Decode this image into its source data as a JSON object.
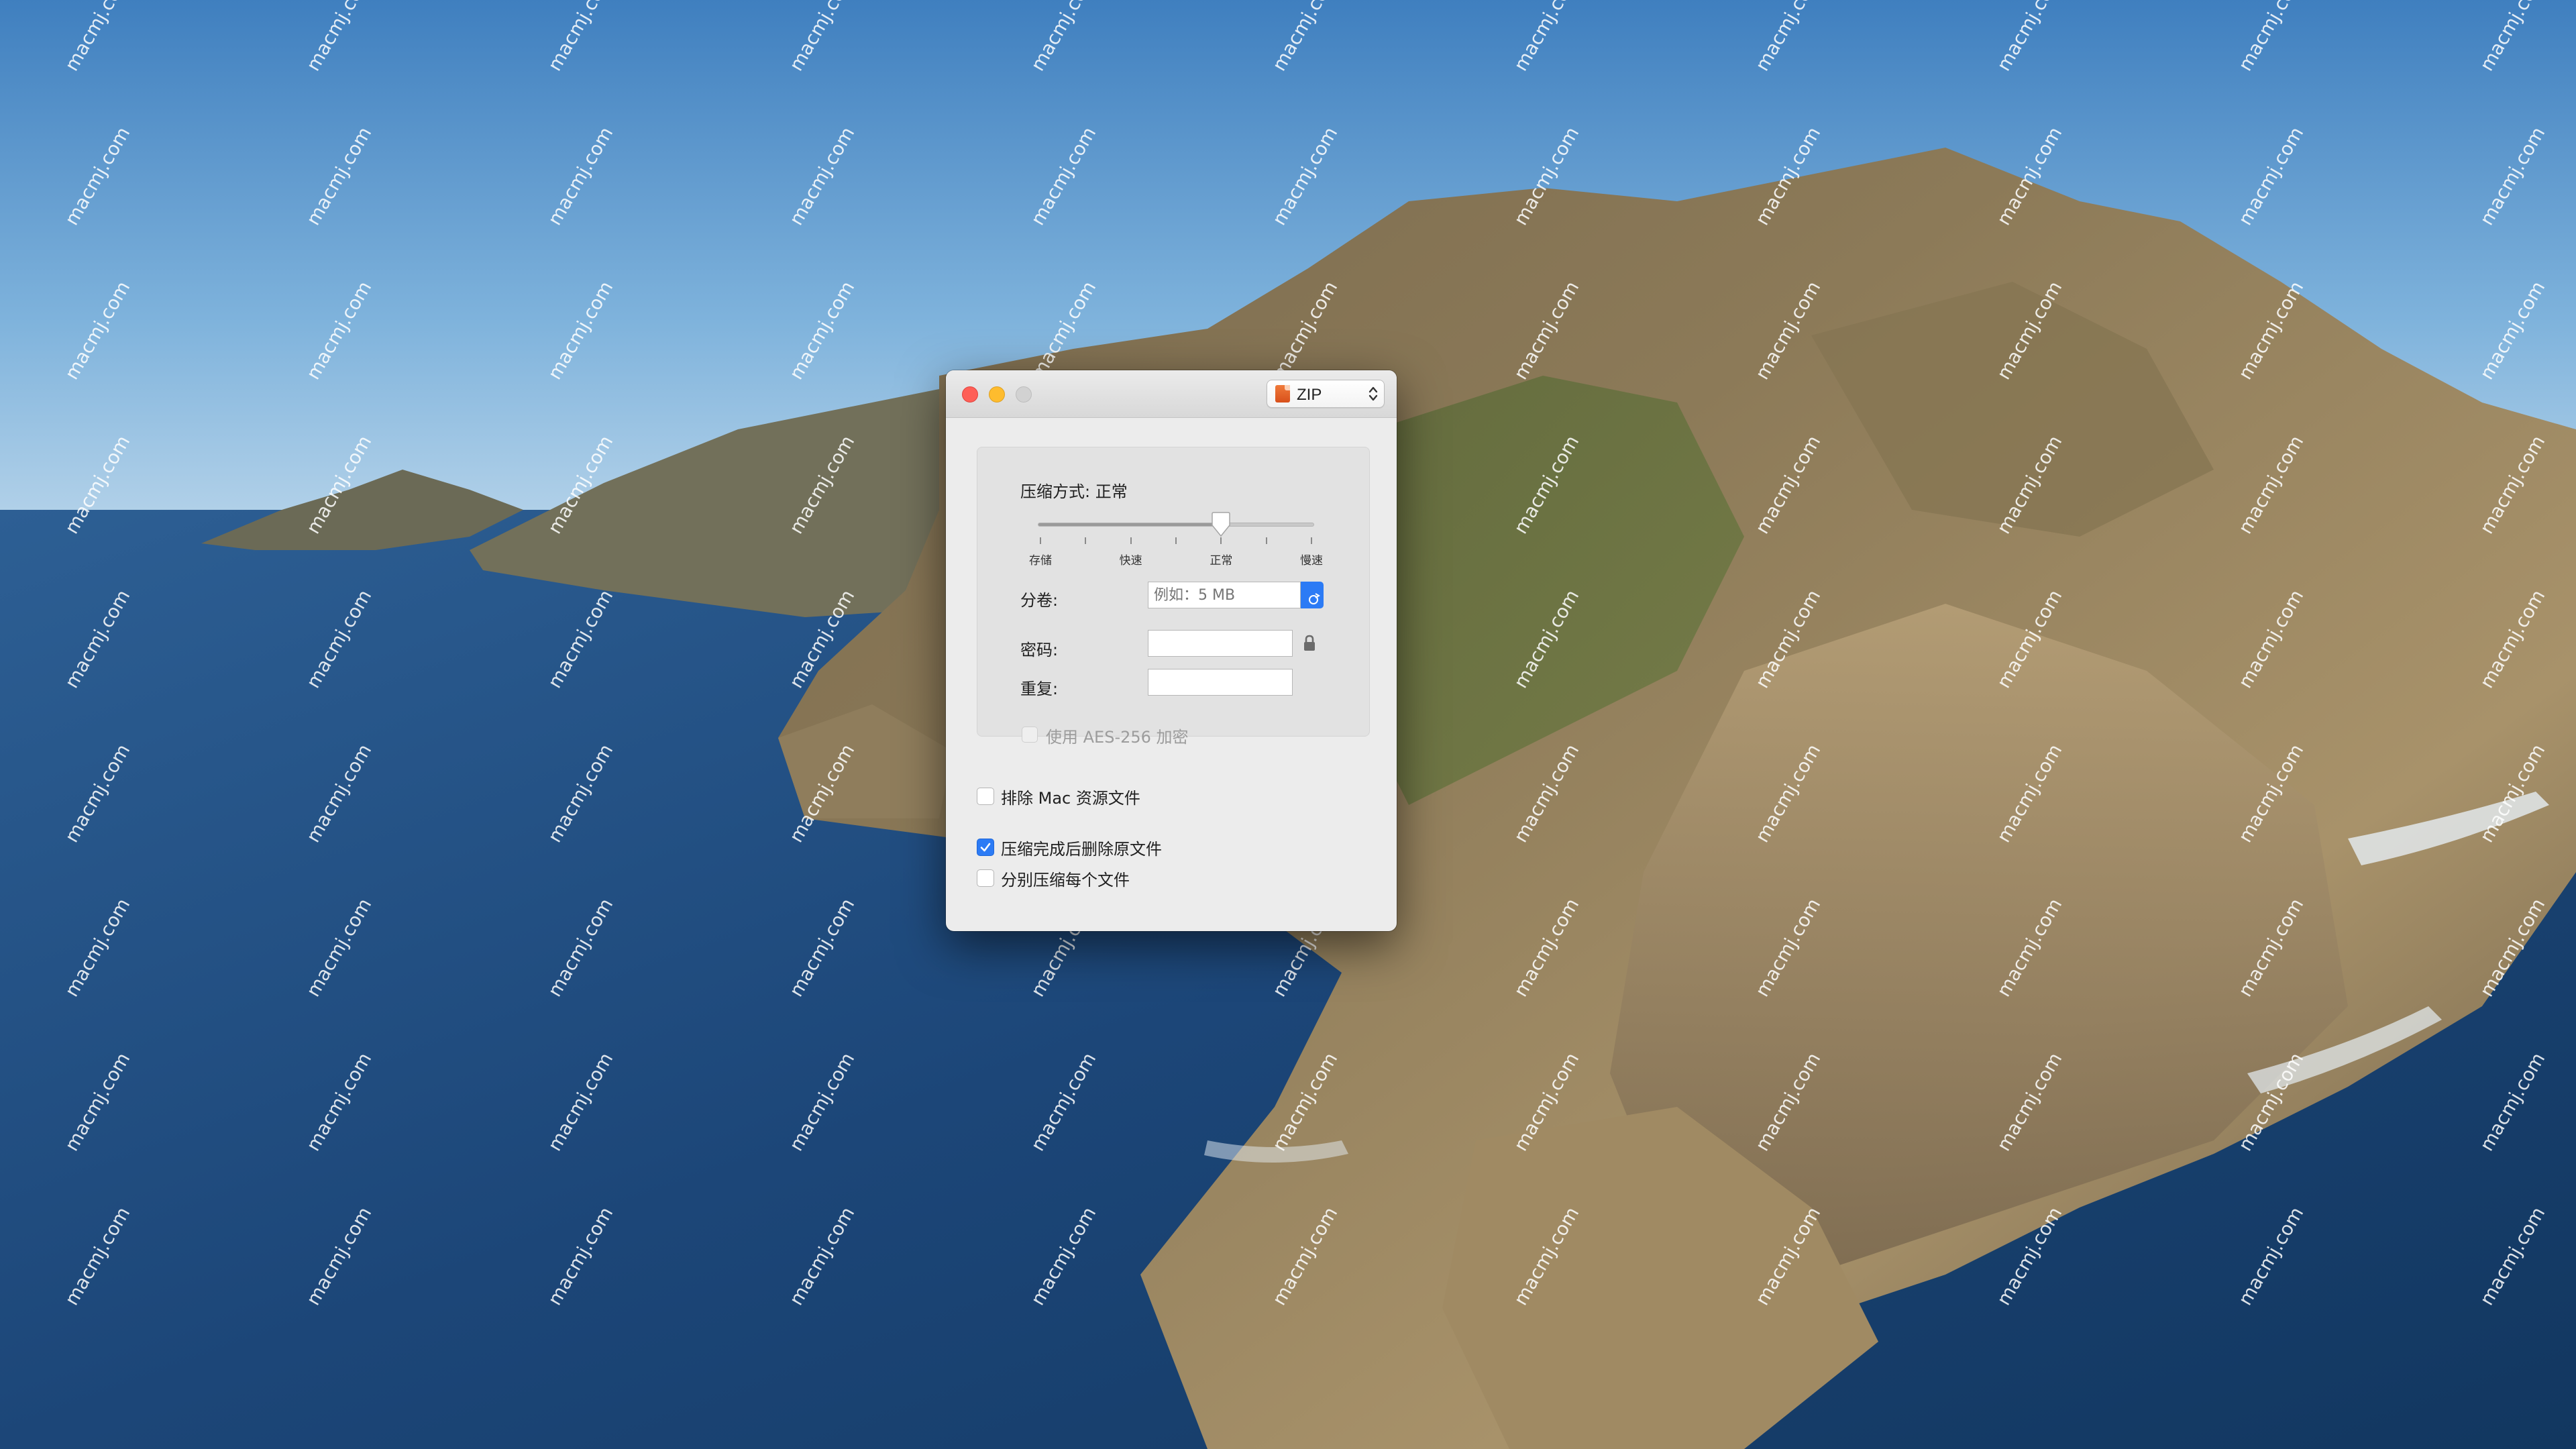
{
  "window": {
    "format": "ZIP",
    "format_icon": "zip-archive-icon"
  },
  "compression": {
    "label": "压缩方式: 正常",
    "level_index": 2,
    "levels": [
      "存储",
      "快速",
      "正常",
      "慢速"
    ]
  },
  "split": {
    "label": "分卷:",
    "placeholder": "例如：5 MB"
  },
  "password": {
    "label": "密码:",
    "value": ""
  },
  "repeat": {
    "label": "重复:",
    "value": ""
  },
  "aes": {
    "label": "使用 AES-256 加密",
    "checked": false,
    "enabled": false
  },
  "options": {
    "exclude_mac": {
      "label": "排除 Mac 资源文件",
      "checked": false
    },
    "delete_after": {
      "label": "压缩完成后删除原文件",
      "checked": true
    },
    "separate": {
      "label": "分别压缩每个文件",
      "checked": false
    }
  },
  "watermark": "macmj.com",
  "colors": {
    "accent": "#2c7bf5",
    "close": "#fe5f57",
    "minimize": "#febc2e",
    "zoom_disabled": "#d2d2d2",
    "window_bg": "#ececec"
  }
}
